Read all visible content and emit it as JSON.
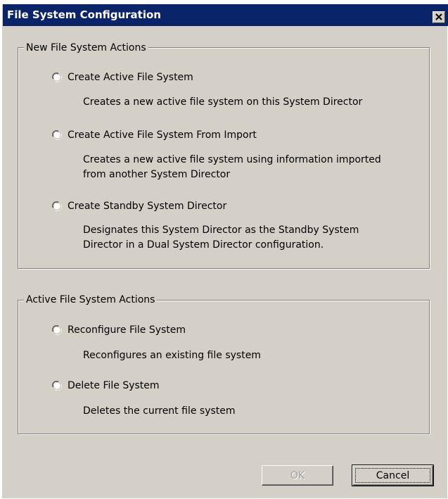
{
  "window": {
    "title": "File System Configuration"
  },
  "new_group": {
    "legend": "New File System Actions",
    "options": [
      {
        "label": "Create Active File System",
        "description": [
          "Creates a new active file system on this System Director"
        ],
        "selected": false
      },
      {
        "label": "Create Active File System From Import",
        "description": [
          "Creates a new active file system using information imported",
          "from another System Director"
        ],
        "selected": false
      },
      {
        "label": "Create Standby System Director",
        "description": [
          "Designates this System Director as the Standby System",
          "Director in a Dual System Director configuration."
        ],
        "selected": false
      }
    ]
  },
  "active_group": {
    "legend": "Active File System Actions",
    "options": [
      {
        "label": "Reconfigure File System",
        "description": [
          "Reconfigures an existing file system"
        ],
        "selected": false
      },
      {
        "label": "Delete File System",
        "description": [
          "Deletes the current file system"
        ],
        "selected": false
      }
    ]
  },
  "buttons": {
    "ok_label": "OK",
    "ok_enabled": false,
    "cancel_label": "Cancel"
  },
  "colors": {
    "titlebar": "#0a246a",
    "face": "#d4d0c8"
  },
  "icons": {
    "close": "close-icon",
    "radio": "radio-unchecked-icon"
  }
}
